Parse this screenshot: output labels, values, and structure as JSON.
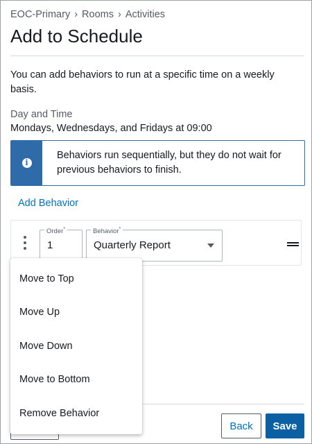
{
  "breadcrumb": {
    "items": [
      "EOC-Primary",
      "Rooms",
      "Activities"
    ],
    "separator": "›"
  },
  "page": {
    "title": "Add to Schedule",
    "intro": "You can add behaviors to run at a specific time on a weekly basis."
  },
  "schedule": {
    "day_time_label": "Day and Time",
    "day_time_value": "Mondays, Wednesdays, and Fridays at 09:00"
  },
  "info_alert": {
    "icon": "info-icon",
    "icon_glyph": "i",
    "text": "Behaviors run sequentially, but they do not wait for previous behaviors to finish.",
    "accent_color": "#2f6ba8"
  },
  "add_behavior": {
    "label": "Add Behavior"
  },
  "behavior_row": {
    "order_label": "Order",
    "order_required_mark": "*",
    "order_value": "1",
    "behavior_label": "Behavior",
    "behavior_required_mark": "*",
    "behavior_value": "Quarterly Report",
    "menu_icon": "more-vertical-icon",
    "drag_icon": "drag-handle-icon"
  },
  "context_menu": {
    "items": [
      {
        "label": "Move to Top"
      },
      {
        "label": "Move Up"
      },
      {
        "label": "Move Down"
      },
      {
        "label": "Move to Bottom"
      },
      {
        "label": "Remove Behavior"
      }
    ]
  },
  "footer": {
    "back_label": "Back",
    "save_label": "Save",
    "primary_color": "#0b5fa3",
    "link_color": "#0073bb"
  }
}
